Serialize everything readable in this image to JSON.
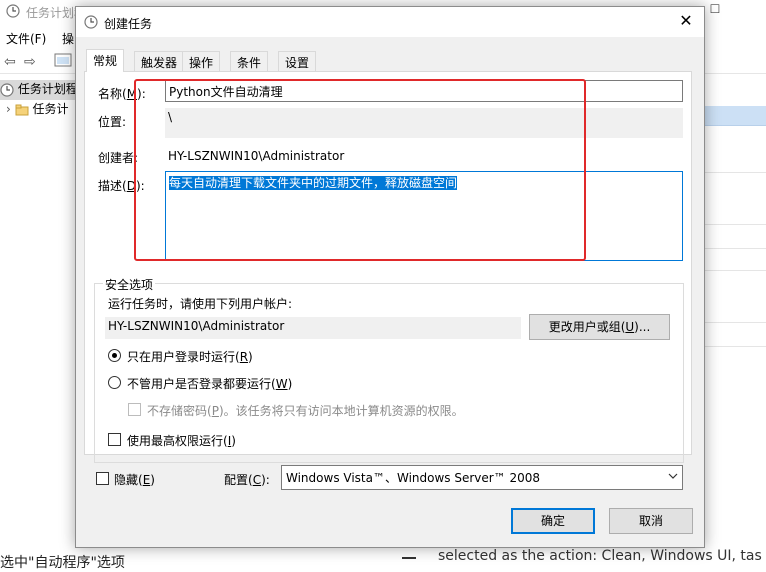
{
  "background_window": {
    "title": "任务计划程",
    "menus": [
      "文件(F)",
      "操"
    ],
    "tree_items": [
      "任务计划程",
      "任务计"
    ],
    "bottom_text_left": "选中\"自动程序\"选项",
    "bottom_text_right": "selected as the action: Clean, Windows UI, tas"
  },
  "dialog": {
    "title": "创建任务",
    "tabs": [
      "常规",
      "触发器",
      "操作",
      "条件",
      "设置"
    ],
    "name_label_prefix": "名称(",
    "name_label_key": "M",
    "name_label_suffix": "):",
    "name_value": "Python文件自动清理",
    "location_label": "位置:",
    "location_value": "\\",
    "author_label": "创建者:",
    "author_value": "HY-LSZNWIN10\\Administrator",
    "description_label_prefix": "描述(",
    "description_label_key": "D",
    "description_label_suffix": "):",
    "description_value": "每天自动清理下载文件夹中的过期文件，释放磁盘空间",
    "security": {
      "group_title": "安全选项",
      "run_as_prompt": "运行任务时，请使用下列用户帐户:",
      "user_account": "HY-LSZNWIN10\\Administrator",
      "change_user_prefix": "更改用户或组(",
      "change_user_key": "U",
      "change_user_suffix": ")...",
      "radio_logged_on_prefix": "只在用户登录时运行(",
      "radio_logged_on_key": "R",
      "radio_logged_on_suffix": ")",
      "radio_logged_on_checked": true,
      "radio_whether_prefix": "不管用户是否登录都要运行(",
      "radio_whether_key": "W",
      "radio_whether_suffix": ")",
      "no_store_password_prefix": "不存储密码(",
      "no_store_password_key": "P",
      "no_store_password_suffix": ")。该任务将只有访问本地计算机资源的权限。",
      "highest_privileges_prefix": "使用最高权限运行(",
      "highest_privileges_key": "I",
      "highest_privileges_suffix": ")"
    },
    "hidden_prefix": "隐藏(",
    "hidden_key": "E",
    "hidden_suffix": ")",
    "configure_prefix": "配置(",
    "configure_key": "C",
    "configure_suffix": "):",
    "configure_value": "Windows Vista™、Windows Server™ 2008",
    "ok_label": "确定",
    "cancel_label": "取消"
  },
  "colors": {
    "highlight": "#0078d7",
    "annotation_box": "#e0292a"
  }
}
